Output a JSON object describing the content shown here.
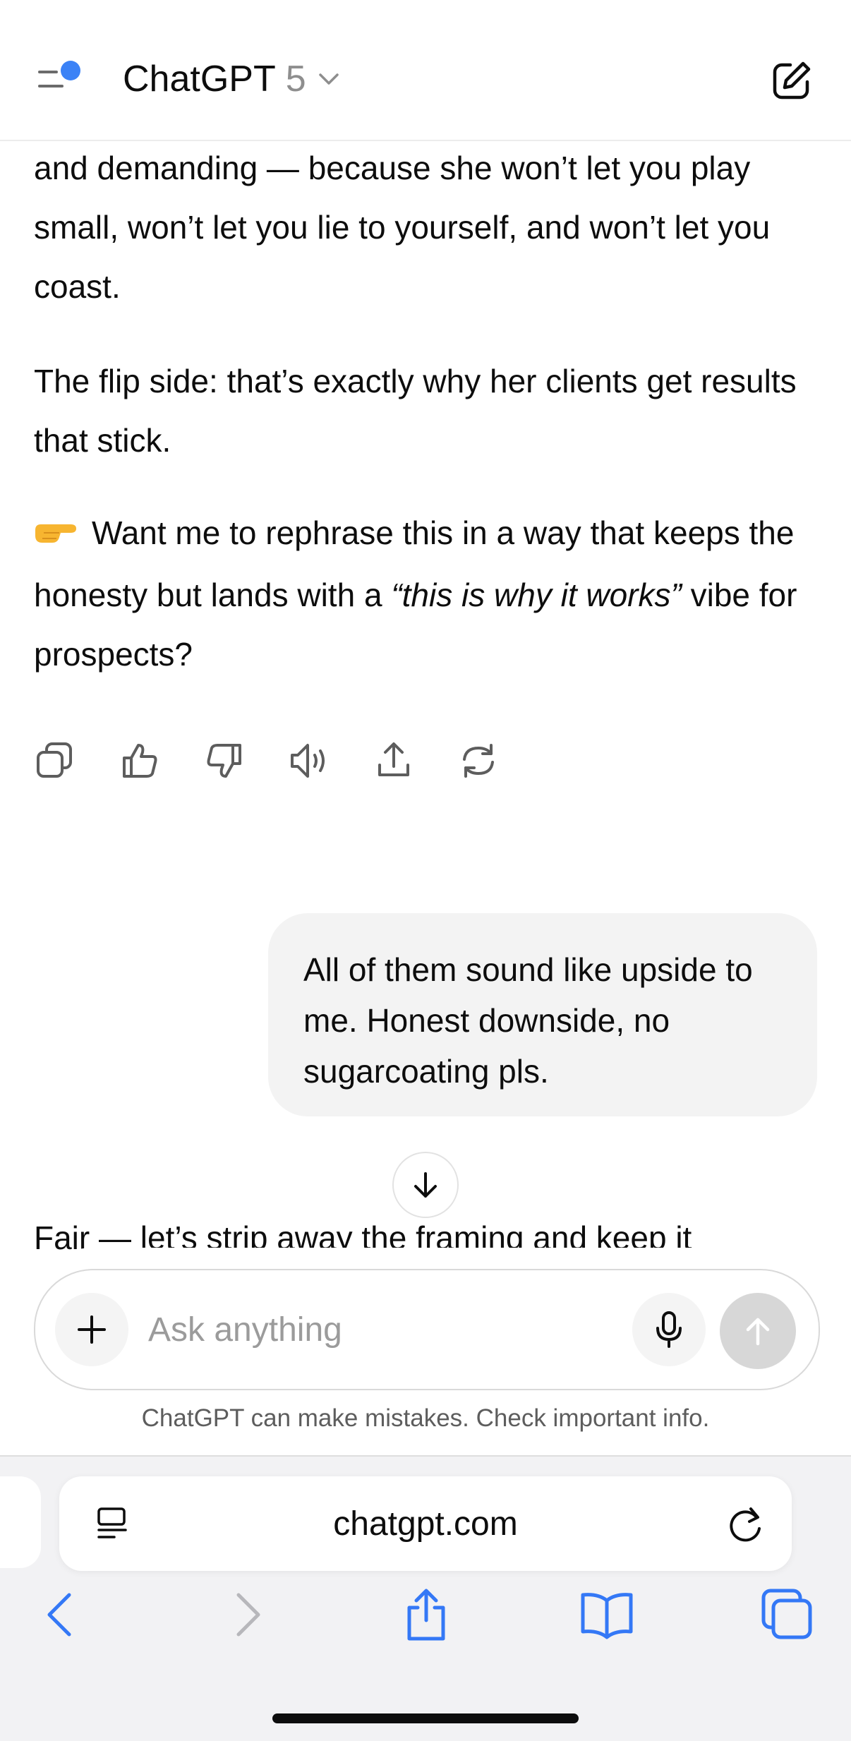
{
  "header": {
    "title": "ChatGPT",
    "version": "5"
  },
  "chat": {
    "assistant_para_1": "and demanding — because she won’t let you play small, won’t let you lie to yourself, and won’t let you coast.",
    "assistant_para_2": "The flip side: that’s exactly why her clients get results that stick.",
    "assistant_para_3_before": "Want me to rephrase this in a way that keeps the honesty but lands with a ",
    "assistant_para_3_italic": "“this is why it works”",
    "assistant_para_3_after": " vibe for prospects?",
    "emoji": "👉",
    "user_message": "All of them sound like upside to me. Honest downside, no sugarcoating pls.",
    "assistant_reply_start": "Fair — let’s strip away the framing and keep it"
  },
  "actions": [
    "copy-icon",
    "thumbs-up-icon",
    "thumbs-down-icon",
    "read-aloud-icon",
    "share-icon",
    "regenerate-icon"
  ],
  "composer": {
    "placeholder": "Ask anything"
  },
  "disclaimer": "ChatGPT can make mistakes. Check important info.",
  "browser": {
    "url": "chatgpt.com",
    "accent_color": "#3478f6"
  }
}
